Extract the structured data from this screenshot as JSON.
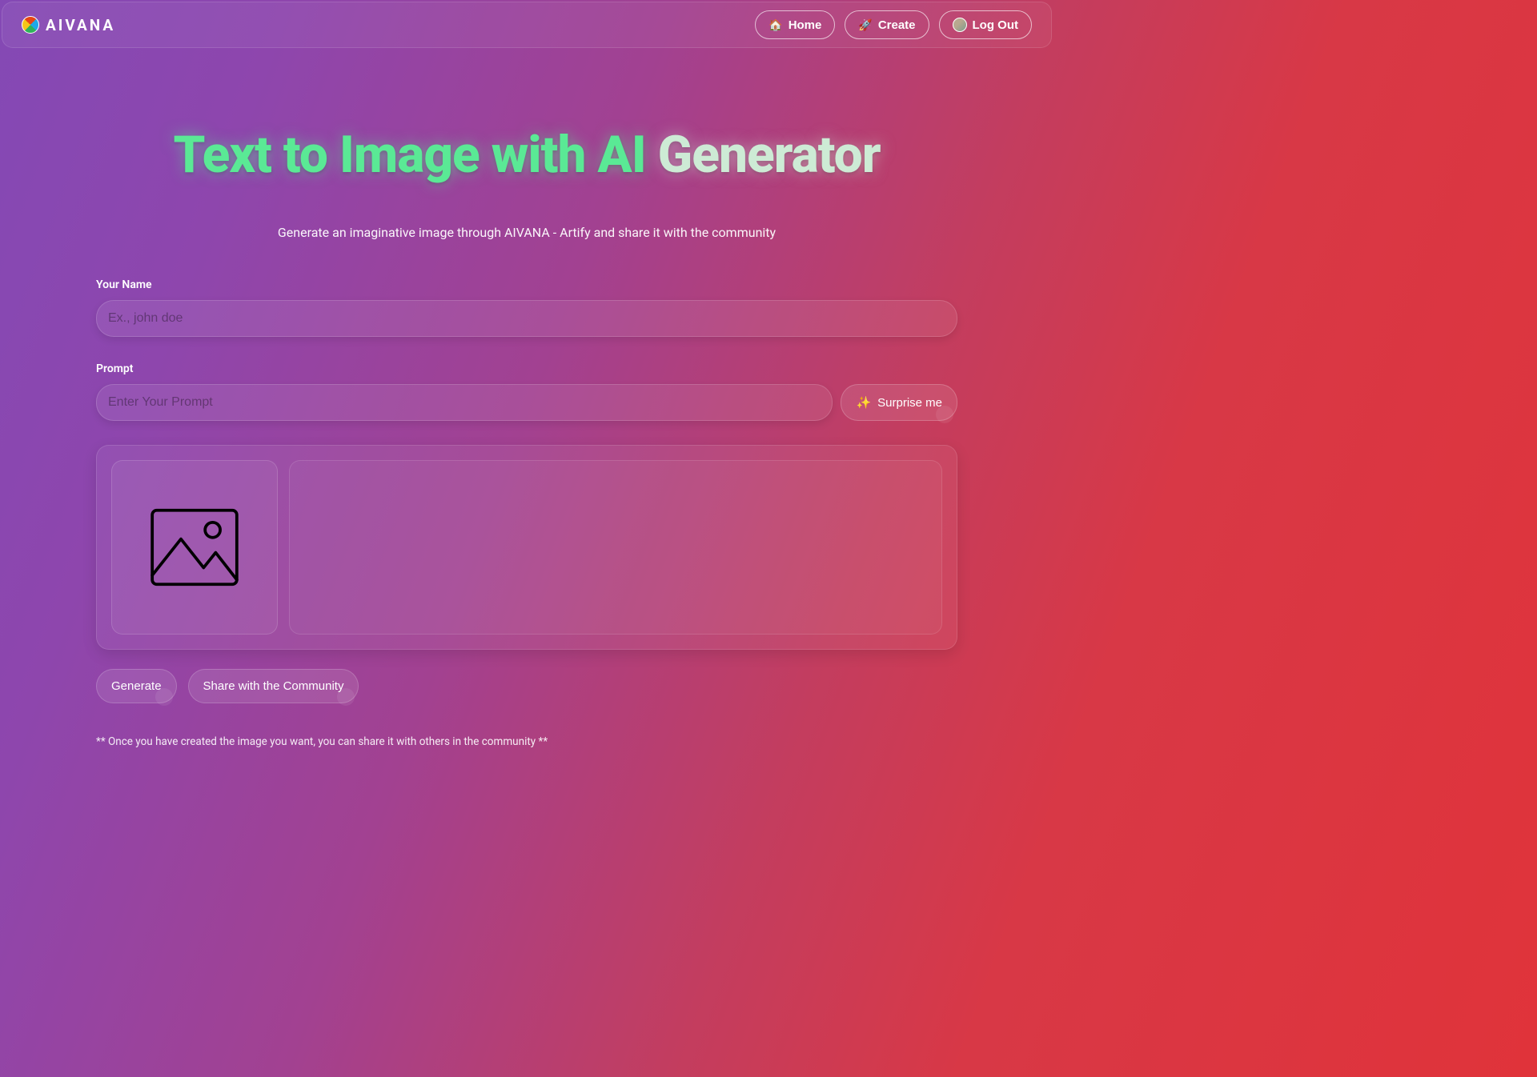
{
  "brand": "AIVANA",
  "nav": {
    "home": {
      "icon": "🏠",
      "label": "Home"
    },
    "create": {
      "icon": "🚀",
      "label": "Create"
    },
    "logout": {
      "label": "Log Out"
    }
  },
  "hero": {
    "title_part1": "Text to Image with AI",
    "title_part2": "Generator",
    "subtitle": "Generate an imaginative image through AIVANA - Artify and share it with the community"
  },
  "form": {
    "name_label": "Your Name",
    "name_placeholder": "Ex., john doe",
    "prompt_label": "Prompt",
    "prompt_placeholder": "Enter Your Prompt",
    "surprise_icon": "✨",
    "surprise_label": "Surprise me"
  },
  "actions": {
    "generate": "Generate",
    "share": "Share with the Community"
  },
  "footnote": "** Once you have created the image you want, you can share it with others in the community **"
}
